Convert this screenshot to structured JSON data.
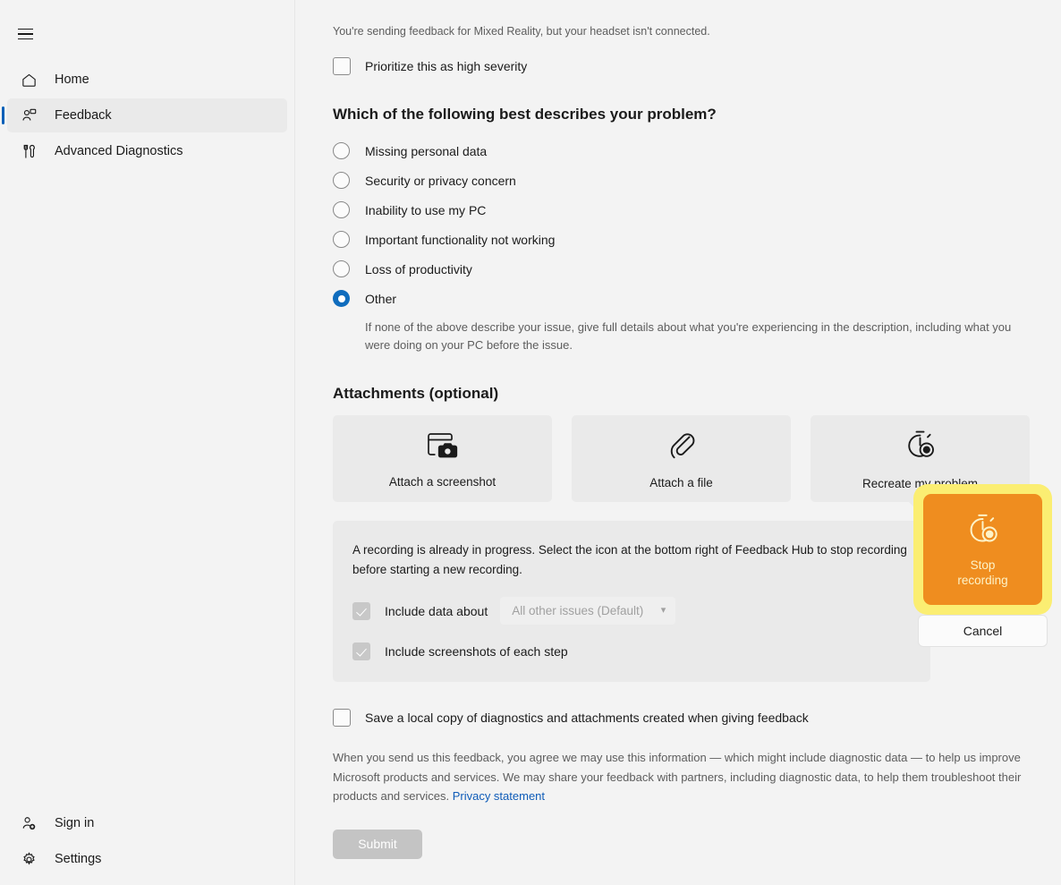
{
  "sidebar": {
    "menu_icon": "hamburger-icon",
    "items": [
      {
        "label": "Home",
        "icon": "home-icon",
        "selected": false
      },
      {
        "label": "Feedback",
        "icon": "feedback-icon",
        "selected": true
      },
      {
        "label": "Advanced Diagnostics",
        "icon": "tools-icon",
        "selected": false
      }
    ],
    "bottom_items": [
      {
        "label": "Sign in",
        "icon": "add-person-icon"
      },
      {
        "label": "Settings",
        "icon": "gear-icon"
      }
    ]
  },
  "main": {
    "headset_note": "You're sending feedback for Mixed Reality, but your headset isn't connected.",
    "priority_checkbox_label": "Prioritize this as high severity",
    "problem_heading": "Which of the following best describes your problem?",
    "problem_options": [
      {
        "label": "Missing personal data",
        "selected": false
      },
      {
        "label": "Security or privacy concern",
        "selected": false
      },
      {
        "label": "Inability to use my PC",
        "selected": false
      },
      {
        "label": "Important functionality not working",
        "selected": false
      },
      {
        "label": "Loss of productivity",
        "selected": false
      },
      {
        "label": "Other",
        "selected": true
      }
    ],
    "other_help_text": "If none of the above describe your issue, give full details about what you're experiencing in the description, including what you were doing on your PC before the issue.",
    "attachments_heading": "Attachments (optional)",
    "attachments": [
      {
        "label": "Attach a screenshot",
        "icon": "screenshot-camera-icon"
      },
      {
        "label": "Attach a file",
        "icon": "paperclip-icon"
      },
      {
        "label": "Recreate my problem",
        "icon": "stopwatch-record-icon"
      }
    ],
    "recording_panel": {
      "message": "A recording is already in progress. Select the icon at the bottom right of Feedback Hub to stop recording before starting a new recording.",
      "include_data_label": "Include data about",
      "include_data_checked": true,
      "dropdown_value": "All other issues (Default)",
      "dropdown_icon": "chevron-down-icon",
      "include_screenshots_label": "Include screenshots of each step",
      "include_screenshots_checked": true
    },
    "stop_callout": {
      "icon": "stopwatch-record-icon",
      "stop_label_line1": "Stop",
      "stop_label_line2": "recording",
      "cancel_label": "Cancel",
      "highlight_color": "#fbee72",
      "button_color": "#ef8d1f"
    },
    "save_copy_label": "Save a local copy of diagnostics and attachments created when giving feedback",
    "legal_text": "When you send us this feedback, you agree we may use this information — which might include diagnostic data — to help us improve Microsoft products and services. We may share your feedback with partners, including diagnostic data, to help them troubleshoot their products and services.",
    "privacy_link": "Privacy statement",
    "submit_label": "Submit"
  }
}
